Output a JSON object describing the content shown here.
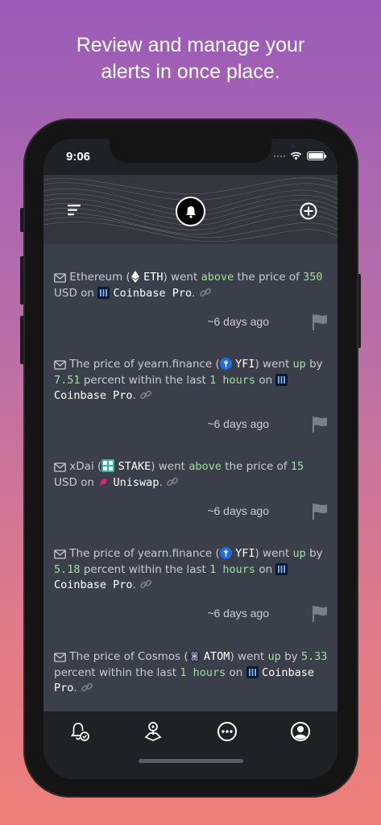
{
  "promo": {
    "line1": "Review and manage your",
    "line2": "alerts in once place."
  },
  "status_bar": {
    "time": "9:06"
  },
  "colors": {
    "highlight": "#9fdf9f",
    "text": "#c9cbd0",
    "screen_bg": "#3b3f49",
    "bar_bg": "#1f2124"
  },
  "header": {
    "menu_icon": "menu-icon",
    "center_icon": "bell-icon",
    "add_icon": "plus-circle-icon"
  },
  "alerts": [
    {
      "prefix": "Ethereum (",
      "symbol": "ETH",
      "mid1": ") went",
      "dir": "above",
      "mid2": "the price of",
      "value": "350",
      "mid3": "USD on",
      "exchange": "Coinbase Pro",
      "end": ".",
      "time_ago": "~6 days ago"
    },
    {
      "prefix": "The price of yearn.finance (",
      "symbol": "YFI",
      "mid1": ") went",
      "dir": "up",
      "mid2": "by",
      "value": "7.51",
      "mid3": "percent within the last",
      "duration": "1 hours",
      "mid4": "on",
      "exchange": "Coinbase Pro",
      "end": ".",
      "time_ago": "~6 days ago"
    },
    {
      "prefix": "xDai (",
      "symbol": "STAKE",
      "mid1": ") went",
      "dir": "above",
      "mid2": "the price of",
      "value": "15",
      "mid3": "USD on",
      "exchange": "Uniswap",
      "end": ".",
      "time_ago": "~6 days ago"
    },
    {
      "prefix": "The price of yearn.finance (",
      "symbol": "YFI",
      "mid1": ") went",
      "dir": "up",
      "mid2": "by",
      "value": "5.18",
      "mid3": "percent within the last",
      "duration": "1 hours",
      "mid4": "on",
      "exchange": "Coinbase Pro",
      "end": ".",
      "time_ago": "~6 days ago"
    },
    {
      "prefix": "The price of Cosmos (",
      "symbol": "ATOM",
      "mid1": ") went",
      "dir": "up",
      "mid2": "by",
      "value": "5.33",
      "mid3": "percent within the last",
      "duration": "1 hours",
      "mid4": "on",
      "exchange": "Coinbase Pro",
      "end": "."
    }
  ],
  "tabs": [
    {
      "icon": "bell-check-icon"
    },
    {
      "icon": "location-pin-icon"
    },
    {
      "icon": "more-circle-icon"
    },
    {
      "icon": "profile-icon"
    }
  ]
}
